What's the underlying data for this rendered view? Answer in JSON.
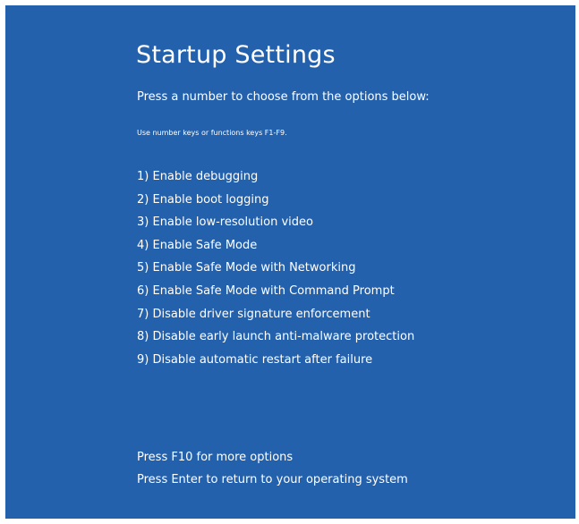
{
  "title": "Startup Settings",
  "subtitle": "Press a number to choose from the options below:",
  "hint": "Use number keys or functions keys F1-F9.",
  "options": [
    "1) Enable debugging",
    "2) Enable boot logging",
    "3) Enable low-resolution video",
    "4) Enable Safe Mode",
    "5) Enable Safe Mode with Networking",
    "6) Enable Safe Mode with Command Prompt",
    "7) Disable driver signature enforcement",
    "8) Disable early launch anti-malware protection",
    "9) Disable automatic restart after failure"
  ],
  "footer": {
    "more_options": "Press F10 for more options",
    "return": "Press Enter to return to your operating system"
  },
  "colors": {
    "background": "#2461ac",
    "text": "#ffffff"
  }
}
